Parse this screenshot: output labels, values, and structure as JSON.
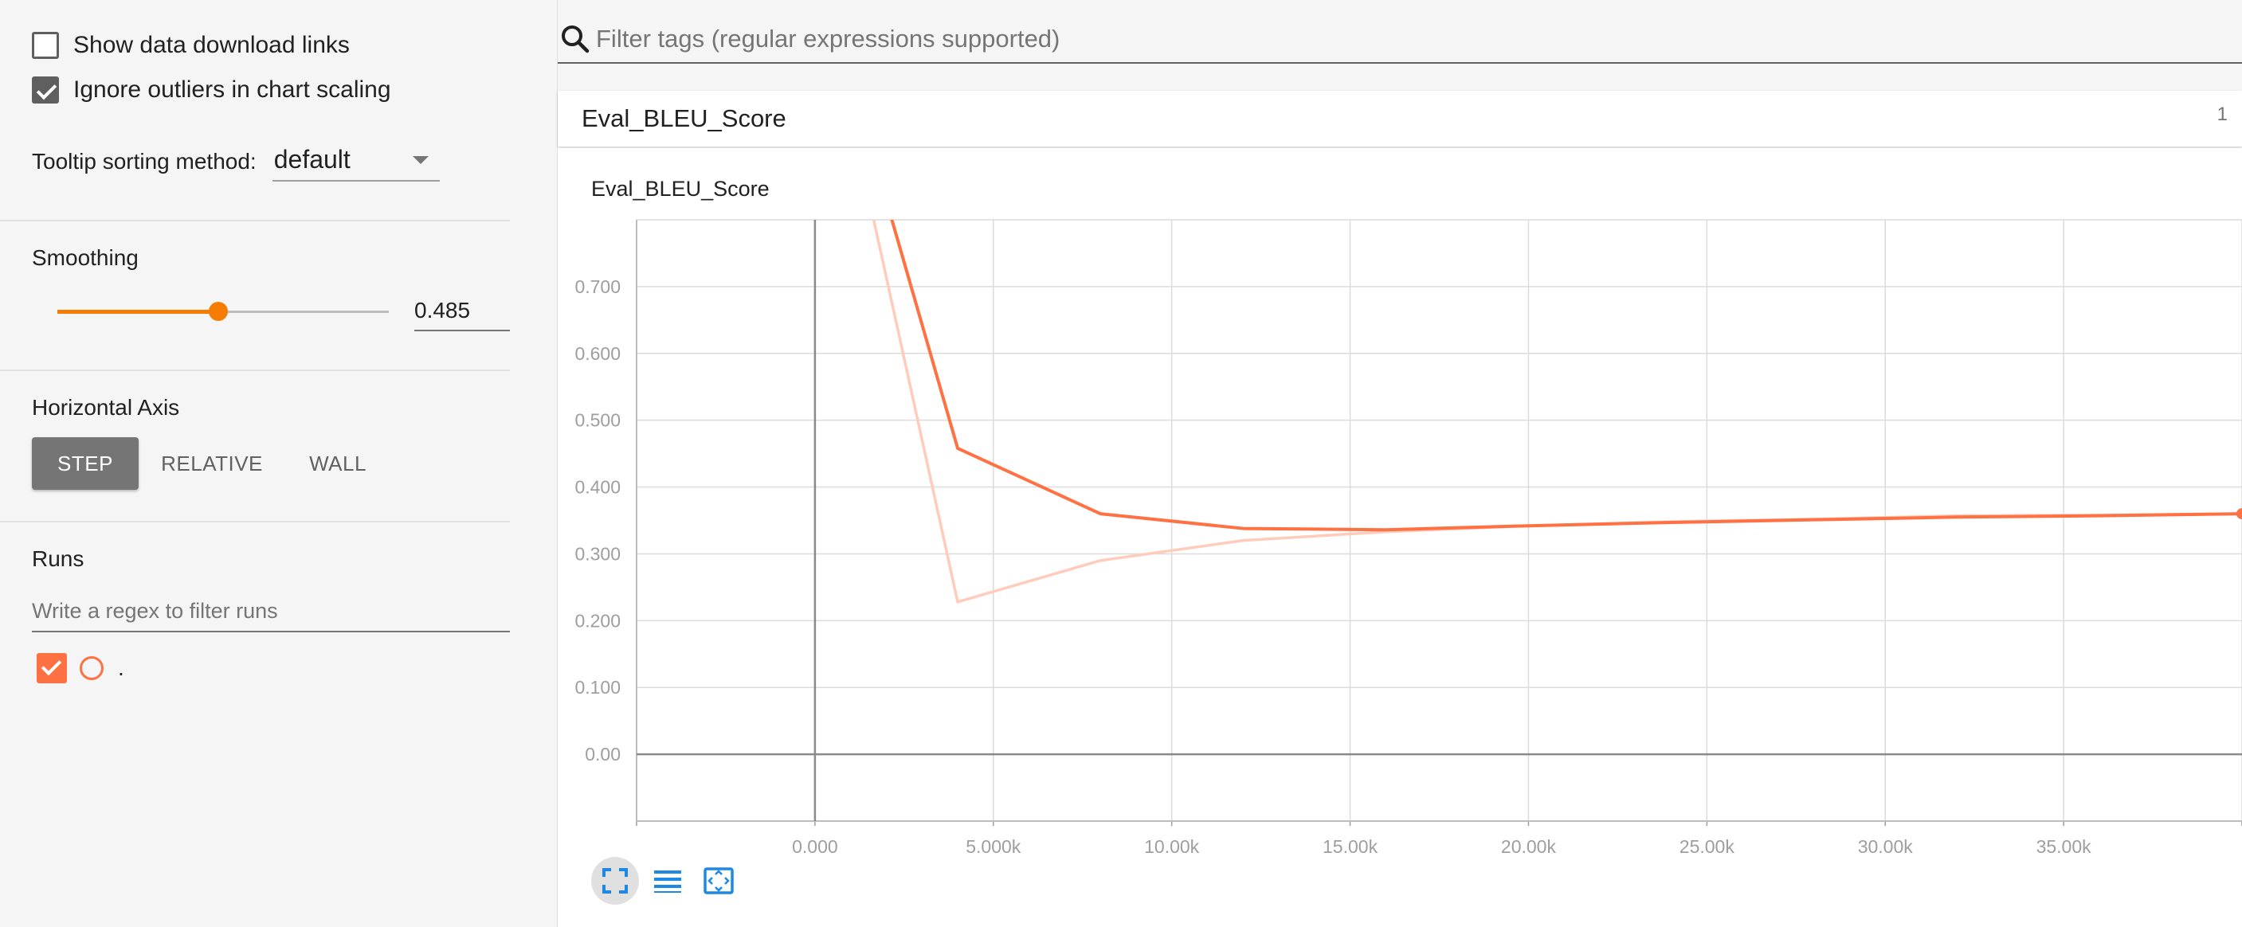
{
  "sidebar": {
    "show_download_links": {
      "label": "Show data download links",
      "checked": false
    },
    "ignore_outliers": {
      "label": "Ignore outliers in chart scaling",
      "checked": true
    },
    "tooltip_sorting": {
      "label": "Tooltip sorting method:",
      "value": "default"
    },
    "smoothing": {
      "title": "Smoothing",
      "value": "0.485",
      "level": 0.485
    },
    "horizontal_axis": {
      "title": "Horizontal Axis",
      "options": [
        "STEP",
        "RELATIVE",
        "WALL"
      ],
      "selected": "STEP"
    },
    "runs": {
      "title": "Runs",
      "placeholder": "Write a regex to filter runs",
      "items": [
        {
          "name": ".",
          "checked": true,
          "color": "#ff7043"
        }
      ]
    }
  },
  "search": {
    "placeholder": "Filter tags (regular expressions supported)"
  },
  "card": {
    "title": "Eval_BLEU_Score",
    "count": "1"
  },
  "colors": {
    "accent": "#f57c00",
    "series": "#ff7043",
    "series_raw": "#ffccbc",
    "button_active": "#757575",
    "toolbar_icon": "#1e88e5"
  },
  "toolbar": {
    "icons": [
      "fit-domain-icon",
      "toggle-log-scale-icon",
      "toggle-y-axis-icon"
    ]
  },
  "chart_data": {
    "type": "line",
    "title": "Eval_BLEU_Score",
    "xlabel": "",
    "ylabel": "",
    "x_ticks": [
      "0.000",
      "5.000k",
      "10.00k",
      "15.00k",
      "20.00k",
      "25.00k",
      "30.00k",
      "35.00k"
    ],
    "y_ticks": [
      "0.00",
      "0.100",
      "0.200",
      "0.300",
      "0.400",
      "0.500",
      "0.600",
      "0.700"
    ],
    "xlim": [
      -5000,
      40000
    ],
    "ylim": [
      -0.1,
      0.8
    ],
    "grid": true,
    "series": [
      {
        "role": "smoothed",
        "x": [
          0,
          4000,
          8000,
          12000,
          16000,
          20000,
          24000,
          28000,
          32000,
          36000,
          40000
        ],
        "y": [
          1.2,
          0.458,
          0.36,
          0.338,
          0.336,
          0.342,
          0.347,
          0.351,
          0.355,
          0.357,
          0.36
        ]
      },
      {
        "role": "raw",
        "x": [
          0,
          4000,
          8000,
          12000,
          16000,
          20000,
          24000,
          28000,
          32000,
          36000,
          40000
        ],
        "y": [
          1.2,
          0.228,
          0.29,
          0.32,
          0.333,
          0.342,
          0.348,
          0.352,
          0.357,
          0.358,
          0.36
        ]
      }
    ]
  }
}
